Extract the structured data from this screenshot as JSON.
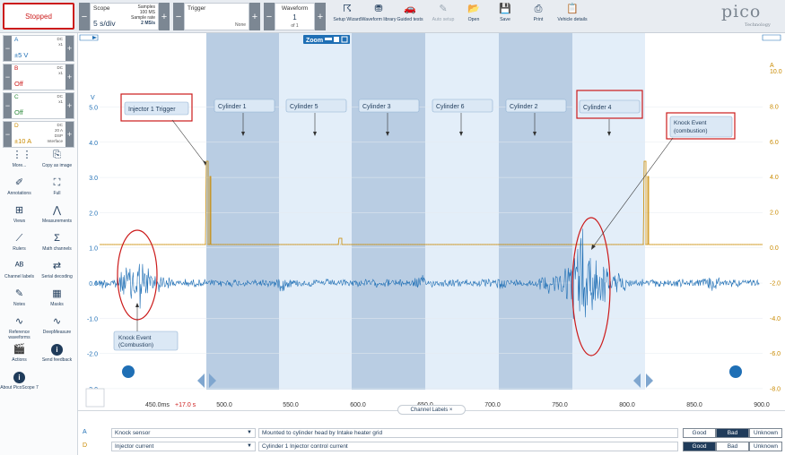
{
  "run": {
    "label": "Stopped"
  },
  "scope": {
    "title": "Scope",
    "timebase": "5 s/div",
    "samples_label": "Samples",
    "samples_value": "100 MS",
    "rate_label": "Sample rate",
    "rate_value": "2 MS/s"
  },
  "trigger": {
    "title": "Trigger",
    "mode": "None"
  },
  "waveform": {
    "title": "Waveform",
    "current": "1",
    "of": "of 1"
  },
  "toolbar": [
    {
      "label": "Setup Wizard",
      "icon": "setup-wizard-icon",
      "glyph": "☈"
    },
    {
      "label": "Waveform library",
      "icon": "waveform-library-icon",
      "glyph": "⛃"
    },
    {
      "label": "Guided tests",
      "icon": "guided-tests-icon",
      "glyph": "🚗"
    },
    {
      "label": "Auto setup",
      "icon": "auto-setup-icon",
      "glyph": "✎"
    },
    {
      "label": "Open",
      "icon": "open-folder-icon",
      "glyph": "📂"
    },
    {
      "label": "Save",
      "icon": "save-icon",
      "glyph": "💾"
    },
    {
      "label": "Print",
      "icon": "print-icon",
      "glyph": "⎙"
    },
    {
      "label": "Vehicle details",
      "icon": "vehicle-details-icon",
      "glyph": "📋"
    }
  ],
  "logo": {
    "name": "pico",
    "sub": "Technology"
  },
  "channels": [
    {
      "name": "A",
      "cpl": "DC",
      "probe": "x1",
      "range": "±5 V",
      "color": "#1f6fb5"
    },
    {
      "name": "B",
      "cpl": "DC",
      "probe": "x1",
      "range": "Off",
      "color": "#cc1b1b"
    },
    {
      "name": "C",
      "cpl": "DC",
      "probe": "x1",
      "range": "Off",
      "color": "#2e8b3d"
    },
    {
      "name": "D",
      "cpl": "DC",
      "probe": "20 A",
      "extra": "DSP",
      "extra2": "Interface",
      "range": "±10 A",
      "color": "#c98a00"
    }
  ],
  "tools": [
    {
      "label": "More...",
      "icon": "more-grid-icon",
      "glyph": "⋮⋮"
    },
    {
      "label": "Copy as image",
      "icon": "copy-image-icon",
      "glyph": "⎘"
    },
    {
      "label": "Annotations",
      "icon": "annotations-icon",
      "glyph": "✐"
    },
    {
      "label": "Full",
      "icon": "fullscreen-icon",
      "glyph": "⛶"
    },
    {
      "label": "Views",
      "icon": "views-icon",
      "glyph": "⊞"
    },
    {
      "label": "Measurements",
      "icon": "measurements-icon",
      "glyph": "⋀"
    },
    {
      "label": "Rulers",
      "icon": "rulers-icon",
      "glyph": "⟋"
    },
    {
      "label": "Math channels",
      "icon": "math-channels-icon",
      "glyph": "Σ"
    },
    {
      "label": "Channel labels",
      "icon": "channel-labels-icon",
      "glyph": "ᴬᴮ"
    },
    {
      "label": "Serial decoding",
      "icon": "serial-decoding-icon",
      "glyph": "⇄"
    },
    {
      "label": "Notes",
      "icon": "notes-icon",
      "glyph": "✎"
    },
    {
      "label": "Masks",
      "icon": "masks-icon",
      "glyph": "▦"
    },
    {
      "label": "Reference waveforms",
      "icon": "reference-waveforms-icon",
      "glyph": "∿"
    },
    {
      "label": "DeepMeasure",
      "icon": "deepmeasure-icon",
      "glyph": "∿"
    },
    {
      "label": "Actions",
      "icon": "actions-icon",
      "glyph": "🎬"
    },
    {
      "label": "Send feedback",
      "icon": "send-feedback-icon",
      "glyph": "i"
    },
    {
      "label": "About PicoScope 7",
      "icon": "about-icon",
      "glyph": "i"
    }
  ],
  "zoom_label": "Zoom",
  "y_left": {
    "unit": "V",
    "ticks": [
      "5.0",
      "4.0",
      "3.0",
      "2.0",
      "1.0",
      "0.0",
      "-1.0",
      "-2.0",
      "-3.0"
    ]
  },
  "y_right": {
    "unit": "A",
    "ticks": [
      "10.0",
      "8.0",
      "6.0",
      "4.0",
      "2.0",
      "0.0",
      "-2.0",
      "-4.0",
      "-6.0",
      "-8.0"
    ]
  },
  "x_axis": {
    "first": "450.0ms",
    "offset": "+17.0 s",
    "ticks": [
      "500.0",
      "550.0",
      "600.0",
      "650.0",
      "700.0",
      "750.0",
      "800.0",
      "850.0",
      "900.0"
    ]
  },
  "cylinders": [
    "Cylinder 1",
    "Cylinder 5",
    "Cylinder 3",
    "Cylinder 6",
    "Cylinder 2",
    "Cylinder 4"
  ],
  "annotations": {
    "injector": "Injector 1 Trigger",
    "knock_left": "Knock Event (Combustion)",
    "knock_right": "Knock Event (combustion)"
  },
  "channel_labels_tab": "Channel Labels",
  "label_rows": [
    {
      "ch": "A",
      "sensor": "Knock sensor",
      "desc": "Mounted to cylinder head by Intake heater grid",
      "selected": "Bad"
    },
    {
      "ch": "D",
      "sensor": "Injector current",
      "desc": "Cylinder 1 Injector control current",
      "selected": "Good"
    }
  ],
  "rating": [
    "Good",
    "Bad",
    "Unknown"
  ]
}
